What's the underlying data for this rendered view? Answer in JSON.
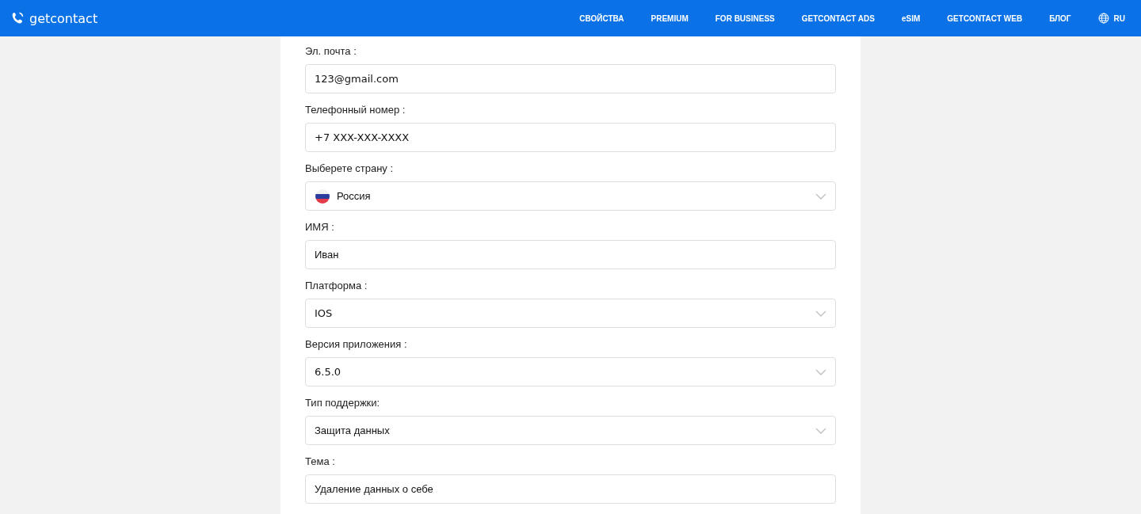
{
  "header": {
    "logo": "getcontact",
    "nav": [
      "СВОЙСТВА",
      "PREMIUM",
      "FOR BUSINESS",
      "GETCONTACT ADS",
      "eSIM",
      "GETCONTACT WEB",
      "БЛОГ"
    ],
    "language": "RU"
  },
  "form": {
    "fields": [
      {
        "kind": "text",
        "label": "Эл. почта :",
        "value": "123@gmail.com"
      },
      {
        "kind": "text",
        "label": "Телефонный номер :",
        "value": "+7 XXX-XXX-XXXX"
      },
      {
        "kind": "country",
        "label": "Выберете страну :",
        "value": "Россия"
      },
      {
        "kind": "text",
        "label": "ИМЯ :",
        "value": "Иван"
      },
      {
        "kind": "select",
        "label": "Платформа :",
        "value": "IOS"
      },
      {
        "kind": "select",
        "label": "Версия приложения :",
        "value": "6.5.0"
      },
      {
        "kind": "select",
        "label": "Тип поддержки:",
        "value": "Защита данных"
      },
      {
        "kind": "text",
        "label": "Тема :",
        "value": "Удаление данных о себе"
      }
    ]
  }
}
